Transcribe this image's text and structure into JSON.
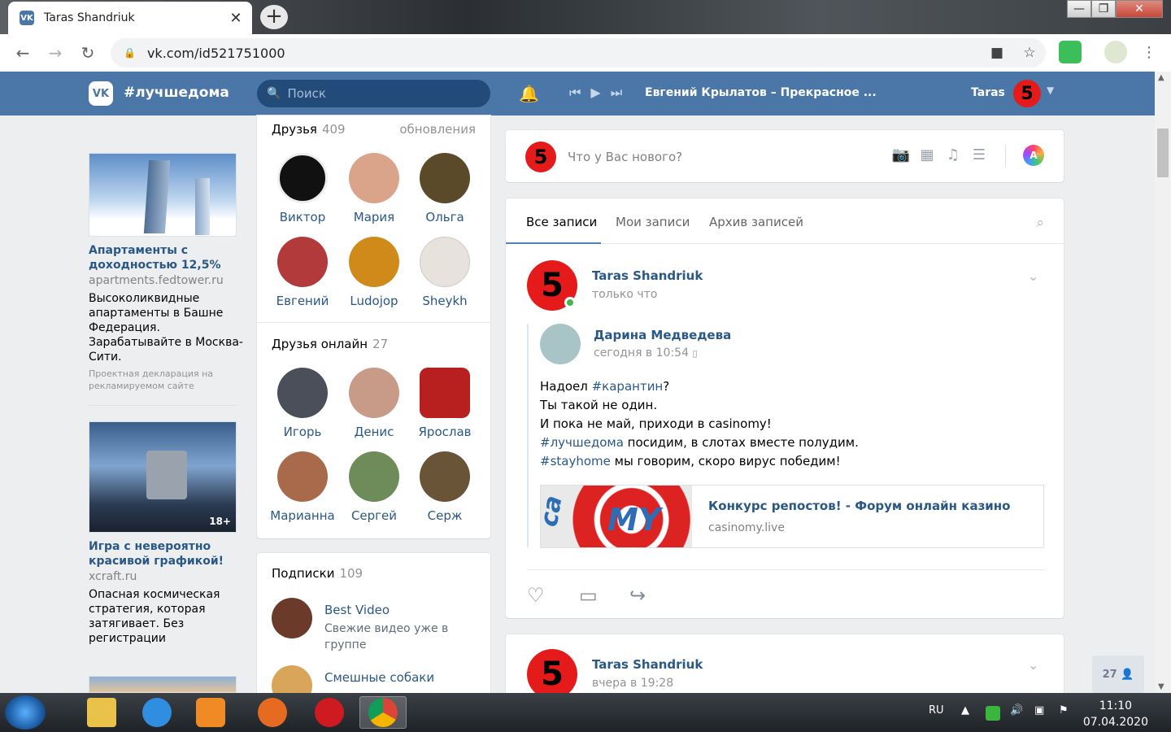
{
  "browser": {
    "tab_title": "Taras Shandriuk",
    "tab_close": "✕",
    "new_tab": "+",
    "url": "vk.com/id521751000",
    "window_min": "—",
    "window_max": "❐",
    "window_close": "✕"
  },
  "header": {
    "logo_text": "VK",
    "brand": "#лучшедома",
    "search_placeholder": "Поиск",
    "track": "Евгений Крылатов – Прекрасное ...",
    "user_name": "Taras",
    "avatar_text": "5"
  },
  "ads": [
    {
      "title": "Апартаменты с доходностью 12,5%",
      "domain": "apartments.fedtower.ru",
      "description": "Высоколиквидные апартаменты в Башне Федерация. Зарабатывайте в Москва-Сити.",
      "note": "Проектная декларация на рекламируемом сайте"
    },
    {
      "badge": "18+",
      "title": "Игра с невероятно красивой графикой!",
      "domain": "xcraft.ru",
      "description": "Опасная космическая стратегия, которая затягивает. Без регистрации"
    }
  ],
  "friends": {
    "title": "Друзья",
    "count": "409",
    "updates": "обновления",
    "items": [
      {
        "name": "Виктор",
        "color": "#111111"
      },
      {
        "name": "Мария",
        "color": "#d9a48a"
      },
      {
        "name": "Ольга",
        "color": "#5b4a2a"
      },
      {
        "name": "Евгений",
        "color": "#b33a3a"
      },
      {
        "name": "Ludojop",
        "color": "#d08a1a"
      },
      {
        "name": "Sheykh",
        "color": "#e8e2dc"
      }
    ]
  },
  "friends_online": {
    "title": "Друзья онлайн",
    "count": "27",
    "items": [
      {
        "name": "Игорь",
        "color": "#4a4f5a"
      },
      {
        "name": "Денис",
        "color": "#c89a88"
      },
      {
        "name": "Ярослав",
        "color": "#b81f1f"
      },
      {
        "name": "Марианна",
        "color": "#a86a4a"
      },
      {
        "name": "Сергей",
        "color": "#6e8c5a"
      },
      {
        "name": "Серж",
        "color": "#6a5438"
      }
    ]
  },
  "subscriptions": {
    "title": "Подписки",
    "count": "109",
    "items": [
      {
        "name": "Best Video",
        "desc": "Свежие видео уже в группе",
        "color": "#6b3a2a"
      },
      {
        "name": "Смешные собаки",
        "desc": "",
        "color": "#d9a55a"
      }
    ]
  },
  "composer": {
    "placeholder": "Что у Вас нового?",
    "avatar_text": "5",
    "ai_label": "A"
  },
  "wall_tabs": {
    "all": "Все записи",
    "mine": "Мои записи",
    "archive": "Архив записей"
  },
  "post1": {
    "author": "Taras Shandriuk",
    "time": "только что",
    "avatar_text": "5",
    "repost_author": "Дарина Медведева",
    "repost_time": "сегодня в 10:54",
    "text_lines": {
      "l1a": "Надоел ",
      "l1tag": "#карантин",
      "l1b": "?",
      "l2": "Ты такой не один.",
      "l3": "И пока не май, приходи в casinomy!",
      "l4tag": "#лучшедома",
      "l4b": " посидим, в слотах вместе полудим.",
      "l5tag": "#stayhome",
      "l5b": " мы говорим, скоро вирус победим!"
    },
    "link_image_text": "MY",
    "link_image_text2": "ca",
    "link_title": "Конкурс репостов! - Форум онлайн казино",
    "link_domain": "casinomy.live"
  },
  "post2": {
    "author": "Taras Shandriuk",
    "time": "вчера в 19:28",
    "avatar_text": "5"
  },
  "friends_online_button": "27 👤",
  "taskbar": {
    "lang": "RU",
    "time": "11:10",
    "date": "07.04.2020"
  }
}
